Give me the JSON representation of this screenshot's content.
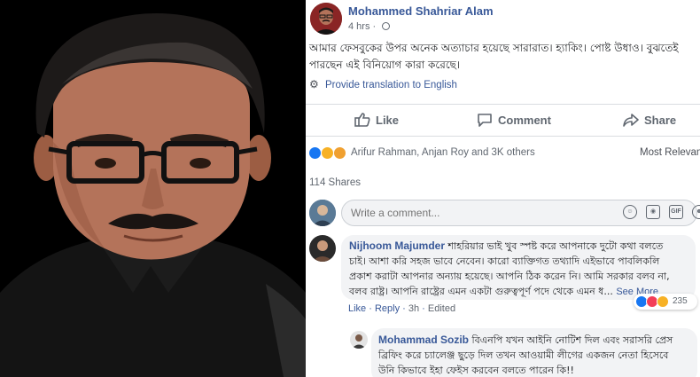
{
  "post": {
    "author": "Mohammed Shahriar Alam",
    "time": "4 hrs · ",
    "text_line1": "আমার ফেসবুকের উপর অনেক অত্যাচার হয়েছে সারারাত। হ্যাকিং। পোষ্ট উধাও। বুঝতেই",
    "text_line2": "পারছেন এই বিনিয়োগ কারা করেছে।",
    "translate": "Provide translation to English"
  },
  "actions": {
    "like": "Like",
    "comment": "Comment",
    "share": "Share"
  },
  "reactions": {
    "names": "Arifur Rahman, Anjan Roy and 3K others",
    "sort": "Most Relevan"
  },
  "shares": "114 Shares",
  "comment_input": {
    "placeholder": "Write a comment..."
  },
  "comments": [
    {
      "name": "Nijhoom Majumder",
      "line1": " শাহরিয়ার ভাই খুব স্পষ্ট করে আপনাকে দুটো কথা বলতে",
      "line2": "চাই। আশা করি সহজ ভাবে নেবেন। কারো ব্যাক্তিগত তথ্যাদি এইভাবে পাবলিকলি",
      "line3": "প্রকাশ করাটা আপনার অন্যায় হয়েছে। আপনি ঠিক করেন নি। আমি সরকার বলব না,",
      "line4": "বলব রাষ্ট্র। আপনি রাষ্ট্রের এমন একটা গুরুত্বপূর্ণ পদে থেকে এমন ধ... ",
      "see_more": "See More",
      "like": "Like",
      "reply": "Reply",
      "time": "3h",
      "edited": "Edited",
      "reaction_count": "235"
    },
    {
      "name": "Mohammad Sozib",
      "line1": " বিএনপি যখন আইনি নোটিশ দিল এবং সরাসরি প্রেস",
      "line2": "ব্রিফিং করে চ্যালেঞ্জ ছুড়ে দিল তখন আওয়ামী লীগের একজন নেতা হিসেবে",
      "line3": "উনি কিভাবে ইহা ফেইস করবেন বলতে পারেন কি!!"
    }
  ],
  "colors": {
    "link_blue": "#385898",
    "fb_like_blue": "#1877f2",
    "haha_yellow": "#f7b125",
    "love_red": "#f33e58",
    "bubble_bg": "#f2f3f5"
  }
}
